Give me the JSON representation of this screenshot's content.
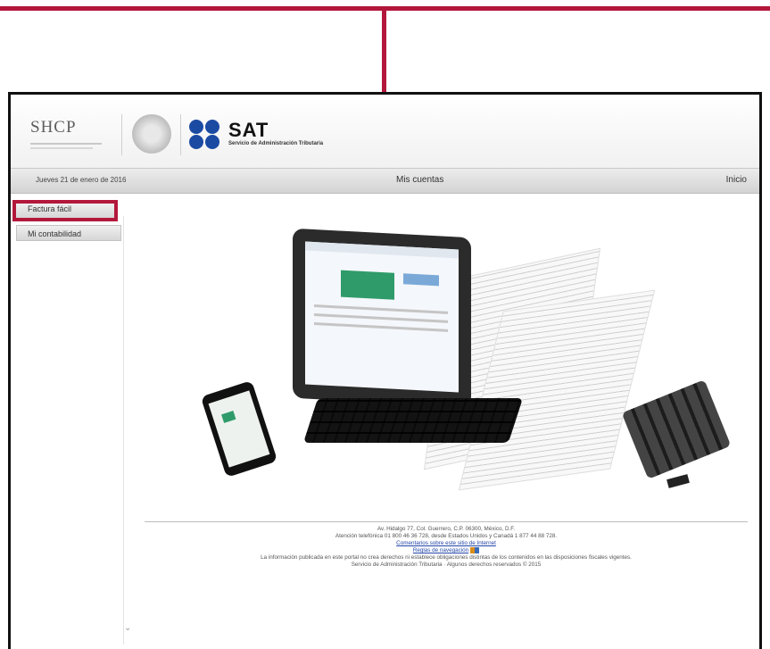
{
  "header": {
    "shcp_label": "SHCP",
    "sat_label": "SAT",
    "sat_subtitle": "Servicio de Administración Tributaria"
  },
  "navbar": {
    "date": "Jueves 21 de enero de 2016",
    "mis_cuentas": "Mis cuentas",
    "inicio": "Inicio"
  },
  "sidebar": {
    "items": [
      {
        "label": "Factura fácil"
      },
      {
        "label": "Mi contabilidad"
      }
    ]
  },
  "footer": {
    "address": "Av. Hidalgo 77, Col. Guerrero, C.P. 06300, México, D.F.",
    "phone": "Atención telefónica 01 800 46 36 728, desde Estados Unidos y Canadá 1 877 44 88 728.",
    "comments_link": "Comentarios sobre este sitio de Internet",
    "nav_rules_link": "Reglas de navegación",
    "disclaimer": "La información publicada en este portal no crea derechos ni establece obligaciones distintas de los contenidos en las disposiciones fiscales vigentes.",
    "copyright": "Servicio de Administración Tributaria · Algunos derechos reservados © 2015"
  },
  "colors": {
    "callout": "#b3173c",
    "sat_blue": "#1b4aa3",
    "link": "#2346a8"
  }
}
